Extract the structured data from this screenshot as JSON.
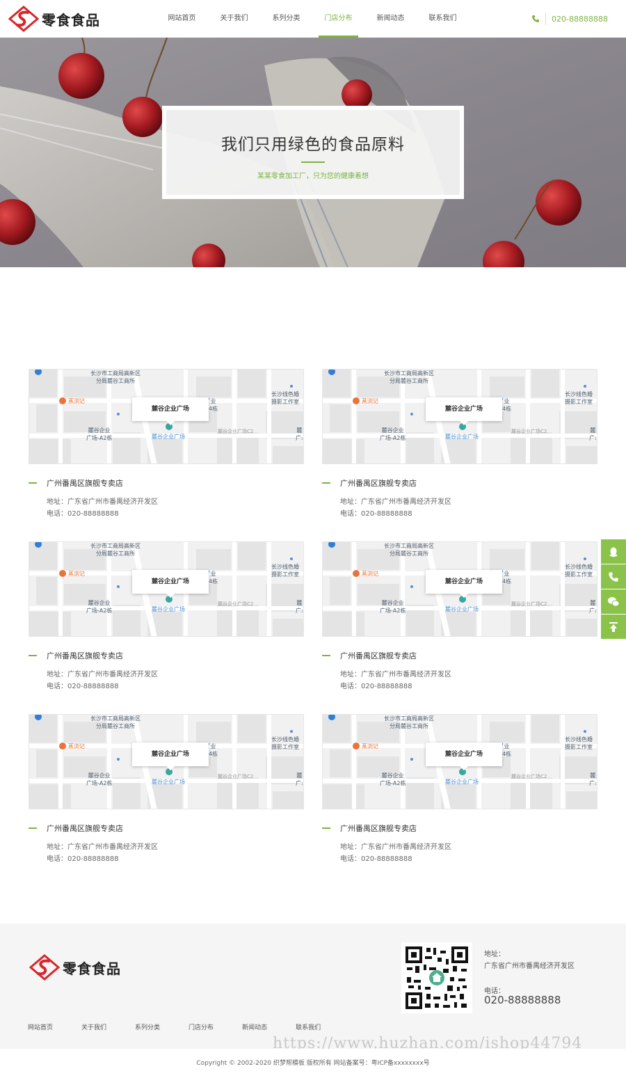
{
  "brand": {
    "name": "零食食品"
  },
  "nav": {
    "items": [
      "网站首页",
      "关于我们",
      "系列分类",
      "门店分布",
      "新闻动态",
      "联系我们"
    ],
    "active_index": 3
  },
  "header": {
    "phone": "020-88888888"
  },
  "banner": {
    "title": "我们只用绿色的食品原料",
    "subtitle": "某某零食加工厂，只为您的健康着想"
  },
  "map_labels": {
    "top": "长沙市工商局高新区\n分局麓谷工商所",
    "poi_orange": "蒸浏记",
    "right_top": "长沙线色婚\n摄影工作室",
    "card": "麓谷企业广场",
    "card_side": "业\n4栋",
    "left_bottom": "麓谷企业\n广场-A2栋",
    "blue_bottom": "麓谷企业广场",
    "grey_bottom": "麓谷企业广场C2",
    "right_edge": "麓\n广:"
  },
  "stores": [
    {
      "name": "广州番禺区旗舰专卖店",
      "address": "地址：广东省广州市番禺经济开发区",
      "phone": "电话：020-88888888"
    },
    {
      "name": "广州番禺区旗舰专卖店",
      "address": "地址：广东省广州市番禺经济开发区",
      "phone": "电话：020-88888888"
    },
    {
      "name": "广州番禺区旗舰专卖店",
      "address": "地址：广东省广州市番禺经济开发区",
      "phone": "电话：020-88888888"
    },
    {
      "name": "广州番禺区旗舰专卖店",
      "address": "地址：广东省广州市番禺经济开发区",
      "phone": "电话：020-88888888"
    },
    {
      "name": "广州番禺区旗舰专卖店",
      "address": "地址：广东省广州市番禺经济开发区",
      "phone": "电话：020-88888888"
    },
    {
      "name": "广州番禺区旗舰专卖店",
      "address": "地址：广东省广州市番禺经济开发区",
      "phone": "电话：020-88888888"
    }
  ],
  "float_bar": {
    "icons": [
      "qq-icon",
      "phone-icon",
      "wechat-icon",
      "back-to-top-icon"
    ]
  },
  "footer": {
    "address_label": "地址：",
    "address": "广东省广州市番禺经济开发区",
    "phone_label": "电话：",
    "phone": "020-88888888",
    "nav": [
      "网站首页",
      "关于我们",
      "系列分类",
      "门店分布",
      "新闻动态",
      "联系我们"
    ],
    "watermark": "https://www.huzhan.com/ishop44794",
    "copyright": "Copyright © 2002-2020 织梦帮模板 版权所有 网站备案号：粤ICP备xxxxxxxx号"
  },
  "colors": {
    "accent": "#7cb342",
    "float_bar": "#8bc34a",
    "logo_red": "#d6262c"
  }
}
